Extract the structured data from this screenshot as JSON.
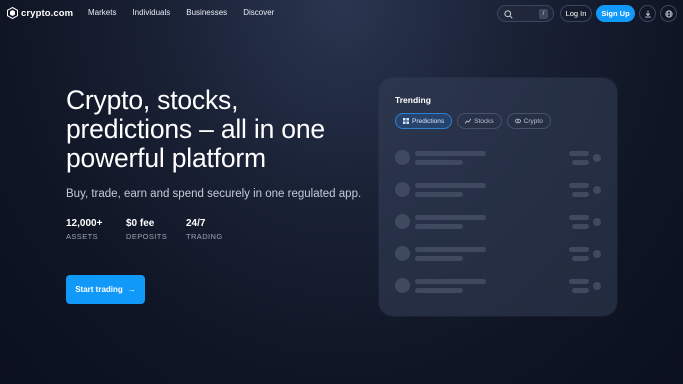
{
  "brand": {
    "name": "crypto.com"
  },
  "nav": {
    "links": [
      "Markets",
      "Individuals",
      "Businesses",
      "Discover"
    ],
    "search_shortcut": "/",
    "login_label": "Log In",
    "signup_label": "Sign Up"
  },
  "hero": {
    "title": "Crypto, stocks, predictions – all in one powerful platform",
    "subtitle": "Buy, trade, earn and spend securely in one regulated app.",
    "stats": [
      {
        "value": "12,000+",
        "label": "ASSETS"
      },
      {
        "value": "$0 fee",
        "label": "DEPOSITS"
      },
      {
        "value": "24/7",
        "label": "TRADING"
      }
    ],
    "cta_label": "Start trading",
    "cta_arrow": "→"
  },
  "trending": {
    "title": "Trending",
    "tabs": [
      {
        "label": "Predictions",
        "icon": "grid-icon",
        "active": true
      },
      {
        "label": "Stocks",
        "icon": "chart-icon",
        "active": false
      },
      {
        "label": "Crypto",
        "icon": "coin-icon",
        "active": false
      }
    ]
  },
  "colors": {
    "accent": "#1199fa",
    "background": "#0f1524"
  }
}
